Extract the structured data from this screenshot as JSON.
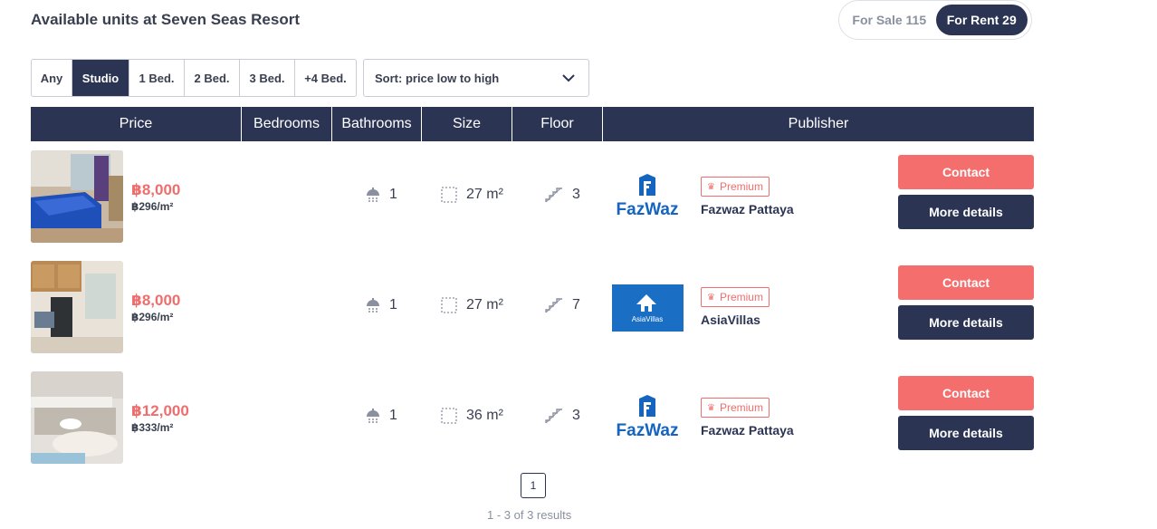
{
  "header": {
    "title": "Available units at Seven Seas Resort",
    "toggle": {
      "sale_label": "For Sale 115",
      "rent_label": "For Rent 29",
      "active": "rent"
    }
  },
  "filters": {
    "bedrooms": [
      "Any",
      "Studio",
      "1 Bed.",
      "2 Bed.",
      "3 Bed.",
      "+4 Bed."
    ],
    "active_bedroom": "Studio",
    "sort_label": "Sort: price low to high"
  },
  "table": {
    "columns": [
      "Price",
      "Bedrooms",
      "Bathrooms",
      "Size",
      "Floor",
      "Publisher"
    ],
    "rows": [
      {
        "price": "฿8,000",
        "price_per_sqm": "฿296/m²",
        "bathrooms": "1",
        "size": "27 m²",
        "floor": "3",
        "publisher": "Fazwaz Pattaya",
        "publisher_logo": "fazwaz",
        "badge": "Premium",
        "contact_label": "Contact",
        "details_label": "More details"
      },
      {
        "price": "฿8,000",
        "price_per_sqm": "฿296/m²",
        "bathrooms": "1",
        "size": "27 m²",
        "floor": "7",
        "publisher": "AsiaVillas",
        "publisher_logo": "asiavillas",
        "badge": "Premium",
        "contact_label": "Contact",
        "details_label": "More details"
      },
      {
        "price": "฿12,000",
        "price_per_sqm": "฿333/m²",
        "bathrooms": "1",
        "size": "36 m²",
        "floor": "3",
        "publisher": "Fazwaz Pattaya",
        "publisher_logo": "fazwaz",
        "badge": "Premium",
        "contact_label": "Contact",
        "details_label": "More details"
      }
    ]
  },
  "logos": {
    "fazwaz_text": "FazWaz",
    "asiavillas_text": "AsiaVillas"
  },
  "pagination": {
    "current_page": "1",
    "results_text": "1 - 3 of 3 results"
  },
  "colors": {
    "navy": "#2b3453",
    "coral": "#f56e6e",
    "fazwaz_blue": "#1565c0",
    "asiavillas_blue": "#1a6fc4"
  }
}
